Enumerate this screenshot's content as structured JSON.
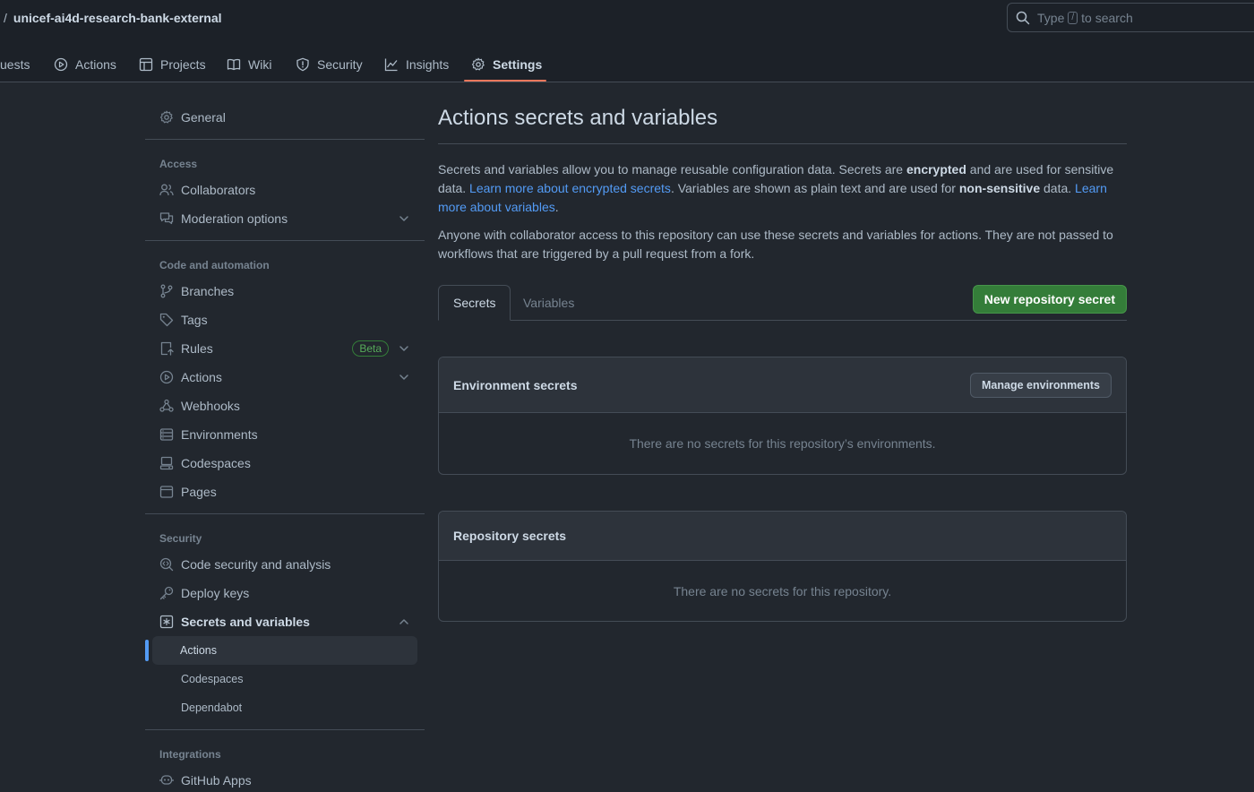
{
  "header": {
    "separator": "/",
    "repo_name": "unicef-ai4d-research-bank-external",
    "search": {
      "prefix": "Type",
      "key": "/",
      "suffix": "to search"
    }
  },
  "repo_nav": {
    "items": [
      {
        "label": "uests",
        "icon": "pull-request-icon"
      },
      {
        "label": "Actions",
        "icon": "play-icon"
      },
      {
        "label": "Projects",
        "icon": "table-icon"
      },
      {
        "label": "Wiki",
        "icon": "book-icon"
      },
      {
        "label": "Security",
        "icon": "shield-icon"
      },
      {
        "label": "Insights",
        "icon": "graph-icon"
      },
      {
        "label": "Settings",
        "icon": "gear-icon",
        "selected": true
      }
    ]
  },
  "sidebar": {
    "general": "General",
    "access_heading": "Access",
    "collaborators": "Collaborators",
    "moderation": "Moderation options",
    "code_heading": "Code and automation",
    "branches": "Branches",
    "tags": "Tags",
    "rules": "Rules",
    "beta": "Beta",
    "actions": "Actions",
    "webhooks": "Webhooks",
    "environments": "Environments",
    "codespaces": "Codespaces",
    "pages": "Pages",
    "security_heading": "Security",
    "code_security": "Code security and analysis",
    "deploy_keys": "Deploy keys",
    "secrets": "Secrets and variables",
    "sub_actions": "Actions",
    "sub_codespaces": "Codespaces",
    "sub_dependabot": "Dependabot",
    "integrations_heading": "Integrations",
    "github_apps": "GitHub Apps"
  },
  "main": {
    "title": "Actions secrets and variables",
    "desc": {
      "p1a": "Secrets and variables allow you to manage reusable configuration data. Secrets are ",
      "p1b": "encrypted",
      "p1c": " and are used for sensitive data. ",
      "link1": "Learn more about encrypted secrets",
      "p1d": ". Variables are shown as plain text and are used for ",
      "p1e": "non-sensitive",
      "p1f": " data. ",
      "link2": "Learn more about variables",
      "p1g": "."
    },
    "desc2": "Anyone with collaborator access to this repository can use these secrets and variables for actions. They are not passed to workflows that are triggered by a pull request from a fork.",
    "tabs": {
      "secrets": "Secrets",
      "variables": "Variables"
    },
    "new_secret_button": "New repository secret",
    "env_box": {
      "title": "Environment secrets",
      "button": "Manage environments",
      "empty": "There are no secrets for this repository’s environments."
    },
    "repo_box": {
      "title": "Repository secrets",
      "empty": "There are no secrets for this repository."
    }
  },
  "colors": {
    "accent": "#539bf5",
    "primary_button": "#347d39",
    "tab_underline": "#ec775c"
  }
}
